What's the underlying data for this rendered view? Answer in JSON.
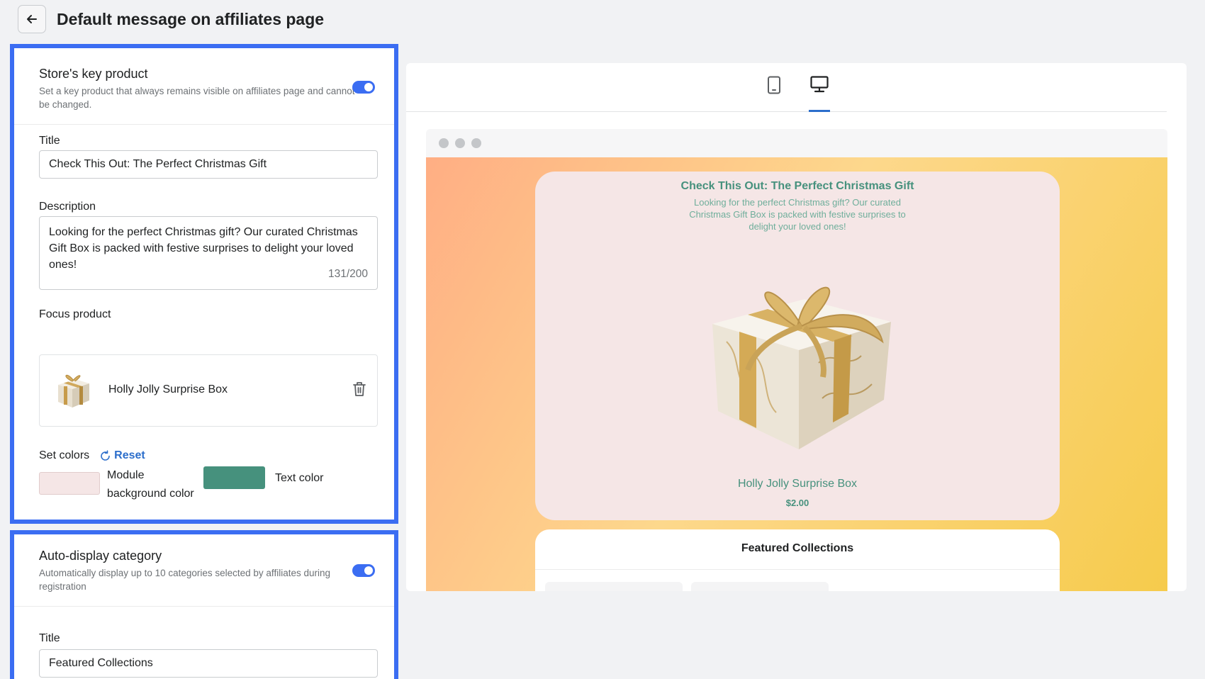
{
  "header": {
    "title": "Default message on affiliates page",
    "back_icon": "arrow-left-icon"
  },
  "key_product": {
    "title": "Store's key product",
    "subtitle": "Set a key product that always remains visible on affiliates page and cannot be changed.",
    "toggle_on": true,
    "title_label": "Title",
    "title_value": "Check This Out: The Perfect Christmas Gift",
    "description_label": "Description",
    "description_value": "Looking for the perfect Christmas gift? Our curated Christmas Gift Box is packed with festive surprises to delight your loved ones!",
    "description_counter": "131/200",
    "focus_label": "Focus product",
    "product_name": "Holly Jolly Surprise Box",
    "set_colors_label": "Set colors",
    "reset_label": "Reset",
    "module_bg_label": "Module background color",
    "text_color_label": "Text color",
    "module_bg_color": "#f5e6e6",
    "text_color": "#46917d"
  },
  "auto_display": {
    "title": "Auto-display category",
    "subtitle": "Automatically display up to 10 categories selected by affiliates during registration",
    "toggle_on": true,
    "title_label": "Title",
    "title_value": "Featured Collections"
  },
  "preview": {
    "devices": [
      "mobile-icon",
      "desktop-icon"
    ],
    "selected_device": "desktop",
    "promo_title": "Check This Out: The Perfect Christmas Gift",
    "promo_description": "Looking for the perfect Christmas gift? Our curated Christmas Gift Box is packed with festive surprises to delight your loved ones!",
    "product_name": "Holly Jolly Surprise Box",
    "price": "$2.00",
    "collections_title": "Featured Collections"
  }
}
